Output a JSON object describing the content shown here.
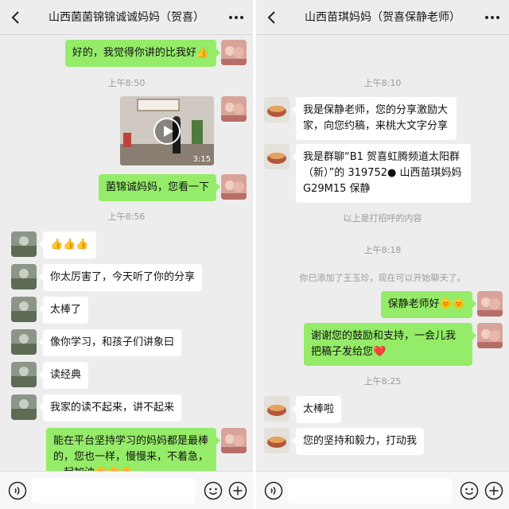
{
  "left": {
    "title": "山西菌菌锦锦诚诚妈妈（贺喜）",
    "messages": {
      "m1": "好的，我觉得你讲的比我好👍",
      "t1": "上午8:50",
      "video_duration": "3:15",
      "m2": "菌锦诚妈妈，您看一下",
      "t2": "上午8:56",
      "m3": "👍👍👍",
      "m4": "你太厉害了，今天听了你的分享",
      "m5": "太棒了",
      "m6": "像你学习，和孩子们讲象曰",
      "m7": "读经典",
      "m8": "我家的读不起来，讲不起来",
      "m9": "能在平台坚持学习的妈妈都是最棒的，您也一样，慢慢来，不着急，一起加油🌼🌼🌼"
    }
  },
  "right": {
    "title": "山西苗琪妈妈（贺喜保静老师）",
    "messages": {
      "t1": "上午8:10",
      "m1": "我是保静老师，您的分享激励大家，向您约稿，来桃大文字分享",
      "m2": "我是群聊“B1 贺喜虹腾频道太阳群（新）”的 319752● 山西苗琪妈妈 G29M15 保静",
      "s1": "以上是打招呼的内容",
      "t2": "上午8:18",
      "s2": "你已添加了王玉珍，现在可以开始聊天了。",
      "m3": "保静老师好🌞🌞",
      "m4": "谢谢您的鼓励和支持，一会儿我把稿子发给您❤️",
      "t3": "上午8:25",
      "m5": "太棒啦",
      "m6": "您的坚持和毅力，打动我"
    }
  },
  "colors": {
    "chat_background": "#ededed",
    "outgoing_bubble": "#95ec69",
    "incoming_bubble": "#ffffff"
  },
  "icons": [
    "back-arrow-icon",
    "more-icon",
    "voice-icon",
    "emoji-icon",
    "plus-icon"
  ]
}
